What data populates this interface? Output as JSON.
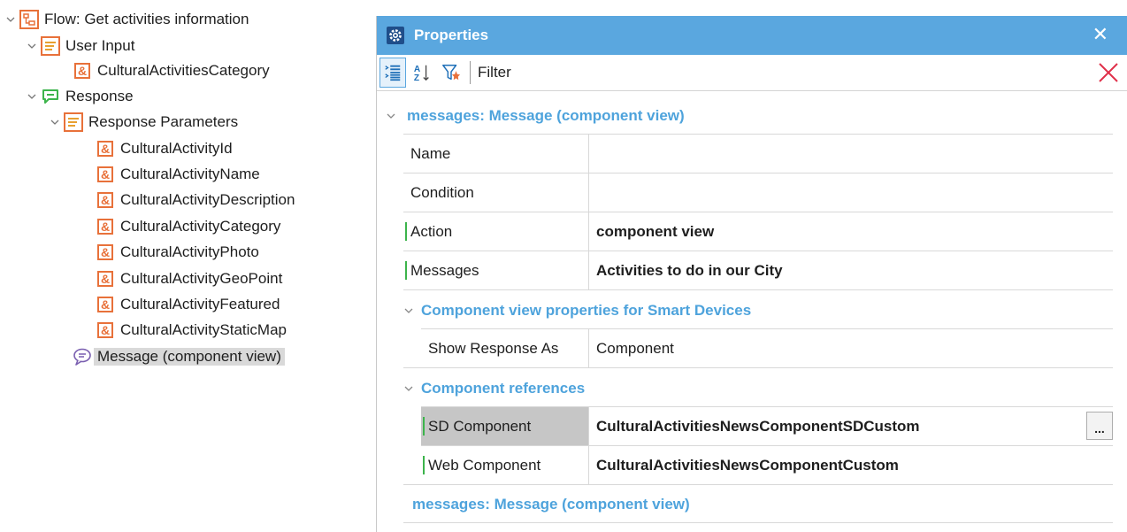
{
  "tree": {
    "root": {
      "label": "Flow: Get activities information",
      "icon": "flow-icon"
    },
    "user_input": {
      "label": "User Input",
      "icon": "parameters-icon",
      "items": [
        "CulturalActivitiesCategory"
      ]
    },
    "response": {
      "label": "Response",
      "icon": "response-icon"
    },
    "response_parameters": {
      "label": "Response Parameters",
      "icon": "parameters-icon",
      "items": [
        "CulturalActivityId",
        "CulturalActivityName",
        "CulturalActivityDescription",
        "CulturalActivityCategory",
        "CulturalActivityPhoto",
        "CulturalActivityGeoPoint",
        "CulturalActivityFeatured",
        "CulturalActivityStaticMap"
      ]
    },
    "message": {
      "label": "Message (component view)",
      "icon": "message-icon",
      "selected": true
    },
    "variable_icon_glyph": "&"
  },
  "properties": {
    "title": "Properties",
    "close_glyph": "✕",
    "toolbar": {
      "filter_label": "Filter",
      "filter_value": "",
      "sort_az_top": "A",
      "sort_az_bottom": "Z"
    },
    "category": "messages: Message (component view)",
    "rows": [
      {
        "name": "Name",
        "value": ""
      },
      {
        "name": "Condition",
        "value": ""
      },
      {
        "name": "Action",
        "value": "component view"
      },
      {
        "name": "Messages",
        "value": "Activities to do in our City"
      }
    ],
    "subcat1": "Component view properties for Smart Devices",
    "subrows1": [
      {
        "name": "Show Response As",
        "value": "Component"
      }
    ],
    "subcat2": "Component references",
    "subrows2": [
      {
        "name": "SD Component",
        "value": "CulturalActivitiesNewsComponentSDCustom",
        "ellipsis": "..."
      },
      {
        "name": "Web Component",
        "value": "CulturalActivitiesNewsComponentCustom"
      }
    ],
    "footer_category": "messages: Message (component view)"
  },
  "colors": {
    "accent": "#5aa7df",
    "category_text": "#4ea3dc",
    "icon_orange": "#e8713a",
    "icon_green": "#3cb44b",
    "modified_mark": "#3cb44b",
    "clear_red": "#e0304a"
  }
}
